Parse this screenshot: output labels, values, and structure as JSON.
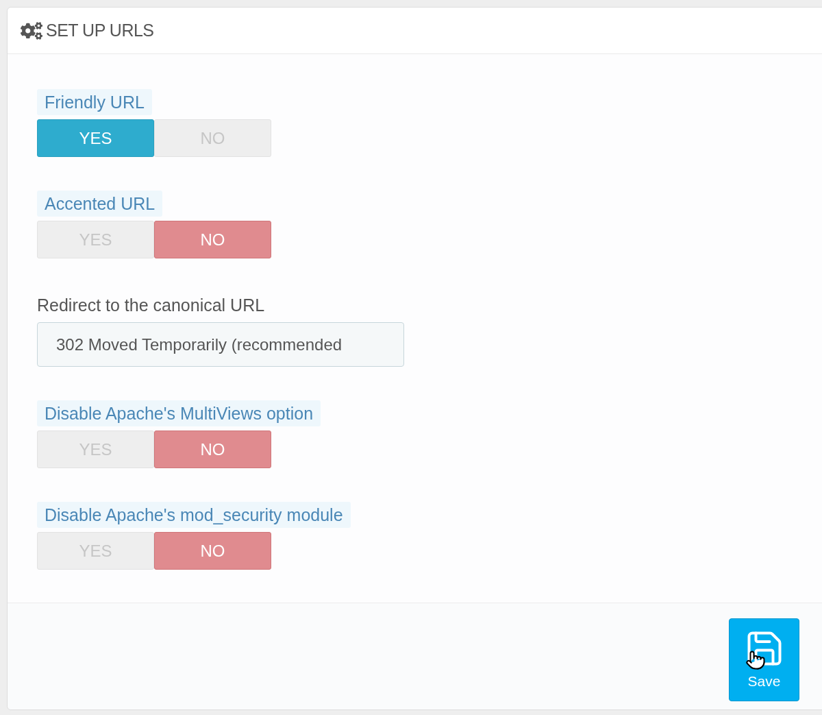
{
  "panel": {
    "title": "SET UP URLS"
  },
  "fields": [
    {
      "kind": "toggle",
      "label": "Friendly URL",
      "options": [
        {
          "label": "YES",
          "selected": true
        },
        {
          "label": "NO",
          "selected": false
        }
      ]
    },
    {
      "kind": "toggle",
      "label": "Accented URL",
      "options": [
        {
          "label": "YES",
          "selected": false
        },
        {
          "label": "NO",
          "selected": true
        }
      ]
    },
    {
      "kind": "select",
      "label": "Redirect to the canonical URL",
      "value": "302 Moved Temporarily (recommended"
    },
    {
      "kind": "toggle",
      "label": "Disable Apache's MultiViews option",
      "options": [
        {
          "label": "YES",
          "selected": false
        },
        {
          "label": "NO",
          "selected": true
        }
      ]
    },
    {
      "kind": "toggle",
      "label": "Disable Apache's mod_security module",
      "options": [
        {
          "label": "YES",
          "selected": false
        },
        {
          "label": "NO",
          "selected": true
        }
      ]
    }
  ],
  "footer": {
    "buttons": [
      {
        "label": "Save"
      }
    ]
  }
}
